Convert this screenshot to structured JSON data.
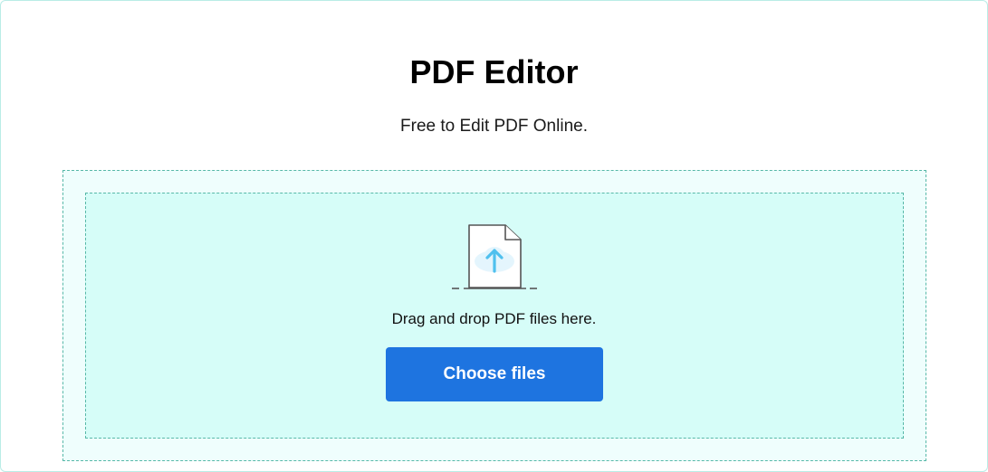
{
  "header": {
    "title": "PDF Editor",
    "subtitle": "Free to Edit PDF Online."
  },
  "dropzone": {
    "icon": "upload-file-icon",
    "instruction": "Drag and drop PDF files here.",
    "choose_button_label": "Choose files"
  },
  "colors": {
    "button": "#1e74e0",
    "dropzone_outer": "#effefd",
    "dropzone_inner": "#d6fdf8",
    "dashed_border": "#57b8a8",
    "icon_arrow": "#4fc0ee"
  }
}
